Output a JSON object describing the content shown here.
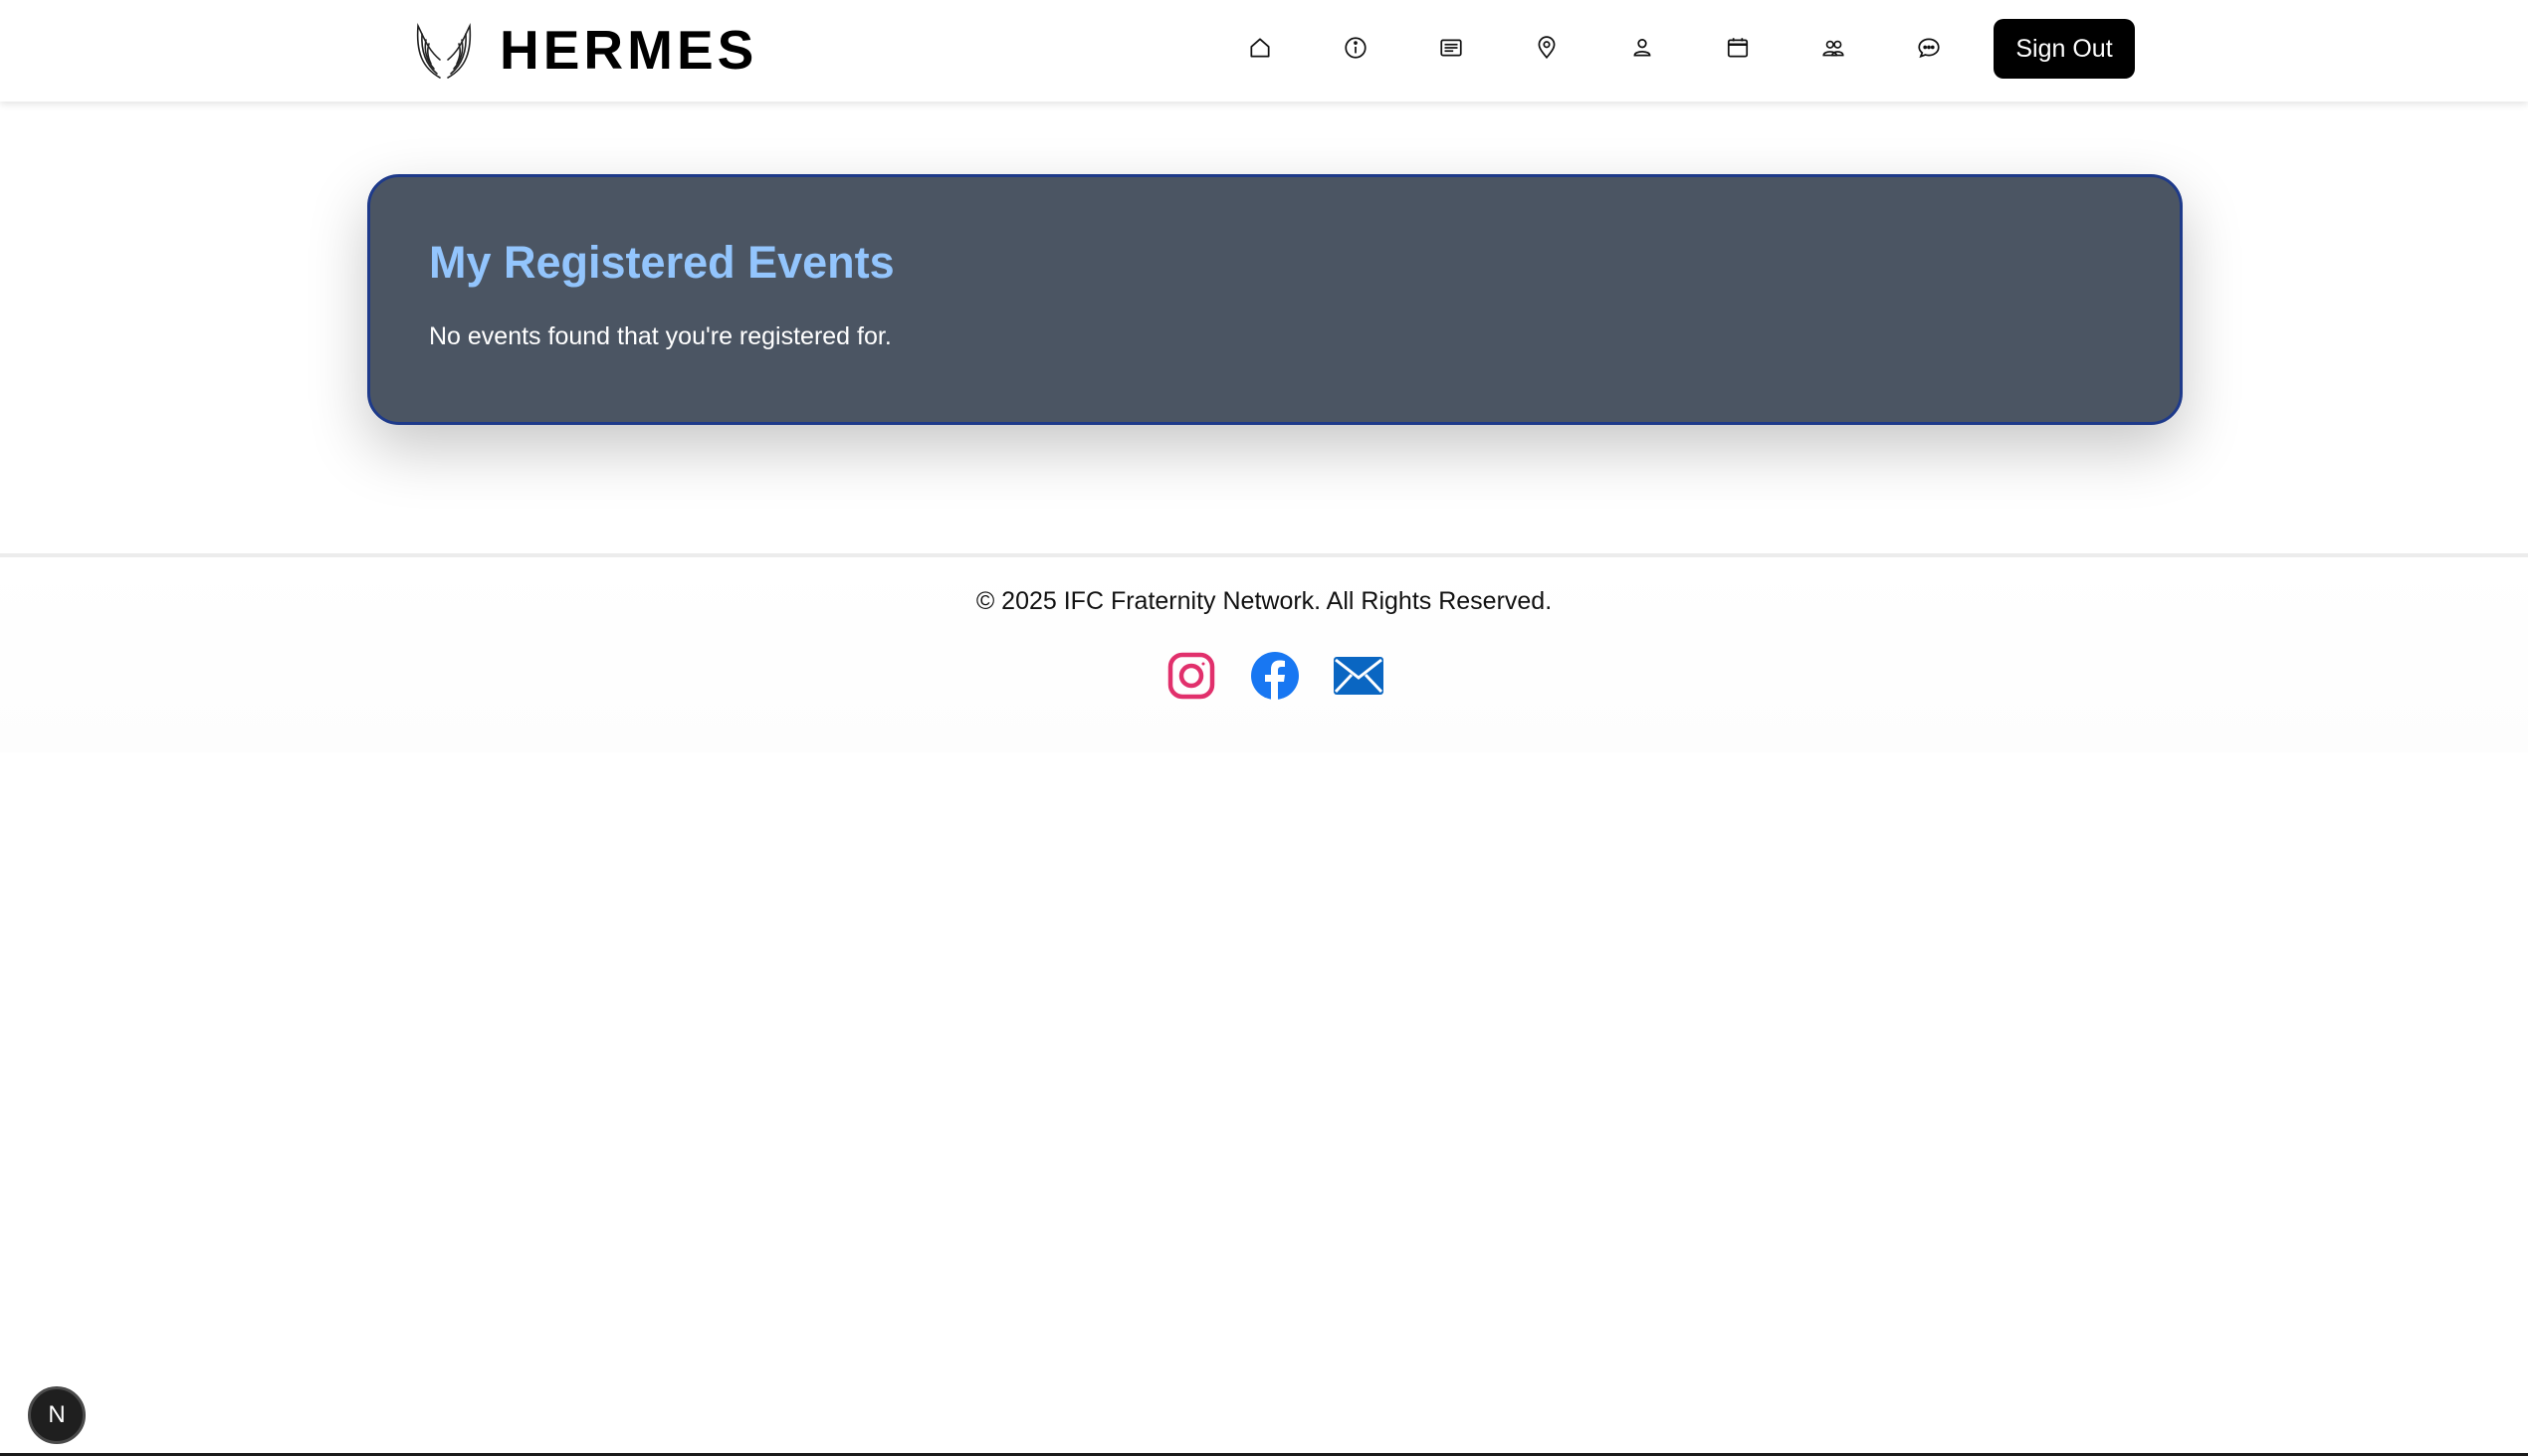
{
  "header": {
    "brand": "HERMES",
    "brand_logo": "winged-logo",
    "nav_icons": [
      "home-icon",
      "info-icon",
      "news-icon",
      "location-icon",
      "profile-icon",
      "calendar-icon",
      "members-icon",
      "chat-icon"
    ],
    "sign_out_label": "Sign Out"
  },
  "main": {
    "title": "My Registered Events",
    "empty_message": "No events found that you're registered for."
  },
  "footer": {
    "copyright": "© 2025 IFC Fraternity Network. All Rights Reserved.",
    "social": [
      "instagram-icon",
      "facebook-icon",
      "email-icon"
    ]
  },
  "dev_badge": {
    "label": "N"
  },
  "colors": {
    "card_bg": "#4b5563",
    "card_border": "#1e3a8a",
    "card_title": "#93c5fd",
    "instagram": "#e1306c",
    "facebook": "#1877f2",
    "email": "#0a66c2"
  }
}
